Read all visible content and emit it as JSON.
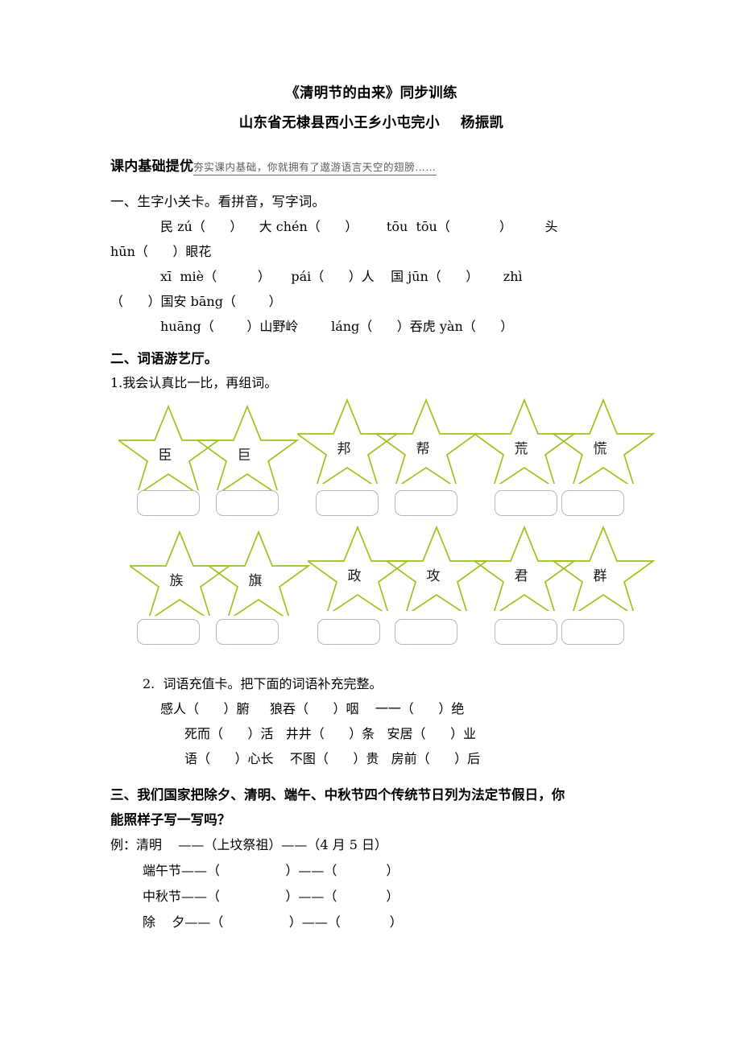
{
  "document": {
    "title": "《清明节的由来》同步训练",
    "subtitle_school": "山东省无棣县西小王乡小屯完小",
    "subtitle_author": "杨振凯"
  },
  "banner": {
    "label": "课内基础提优",
    "tagline": "夯实课内基础，你就拥有了遨游语言天空的翅膀……"
  },
  "section1": {
    "heading": "一、生字小关卡。看拼音，写字词。",
    "line1": "民 zú（      ）    大 chén（      ）       tōu  tōu（            ）        头",
    "line2": "hūn（      ）眼花",
    "line3": "xī  miè（          ）     pái（      ）人    国 jūn（      ）      zhì",
    "line4": "（      ）国安 bāng（        ）",
    "line5": "huāng（        ）山野岭        láng（      ）吞虎 yàn（      ）"
  },
  "section2": {
    "heading": "二、词语游艺厅。",
    "sub1": "1.我会认真比一比，再组词。",
    "star_rows": [
      {
        "groups": [
          {
            "left_char": "臣",
            "right_char": "巨"
          },
          {
            "left_char": "邦",
            "right_char": "帮"
          },
          {
            "left_char": "荒",
            "right_char": "慌"
          }
        ]
      },
      {
        "groups": [
          {
            "left_char": "族",
            "right_char": "旗"
          },
          {
            "left_char": "政",
            "right_char": "攻"
          },
          {
            "left_char": "君",
            "right_char": "群"
          }
        ]
      }
    ],
    "sub2": "2.  词语充值卡。把下面的词语补充完整。",
    "fill_lines": [
      "感人（      ）腑     狼吞（      ）咽    一一（      ）绝",
      "死而（      ）活   井井（      ）条   安居（      ）业",
      "语（      ）心长    不图（      ）贵   房前（      ）后"
    ]
  },
  "section3": {
    "heading_line1": "三、我们国家把除夕、清明、端午、中秋节四个传统节日列为法定节假日，你",
    "heading_line2": "能照样子写一写吗？",
    "example": "例：清明    ——（上坟祭祖）——（4 月 5 日）",
    "items": [
      "端午节——（                ）——（            ）",
      "中秋节——（                ）——（            ）",
      "除    夕——（                ）——（            ）"
    ]
  },
  "colors": {
    "star_stroke": "#9DC31C",
    "box_border": "#b9b4c4",
    "tagline_text": "#5a5a5a"
  }
}
